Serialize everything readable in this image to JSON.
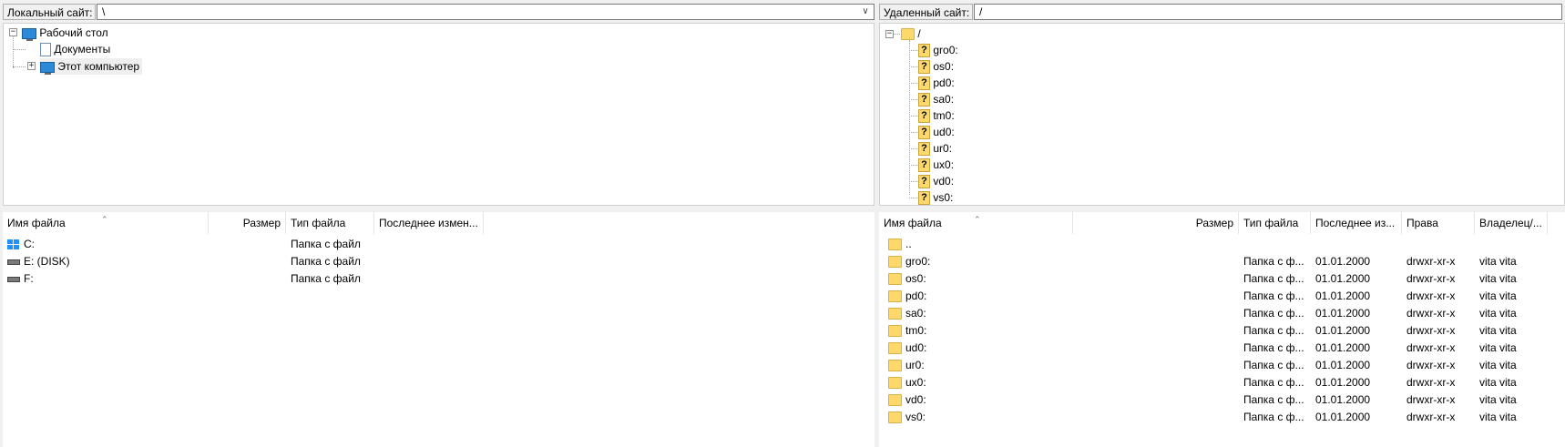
{
  "local": {
    "site_label": "Локальный сайт:",
    "path": "\\",
    "tree": [
      {
        "label": "Рабочий стол",
        "icon": "desktop-icon",
        "expander": "−"
      },
      {
        "label": "Документы",
        "icon": "documents-icon"
      },
      {
        "label": "Этот компьютер",
        "icon": "computer-icon",
        "expander": "+"
      }
    ],
    "columns": [
      "Имя файла",
      "Размер",
      "Тип файла",
      "Последнее измен..."
    ],
    "files": [
      {
        "name": "C:",
        "size": "",
        "type": "Папка с файл",
        "modified": "",
        "icon": "windows-drive-icon"
      },
      {
        "name": "E: (DISK)",
        "size": "",
        "type": "Папка с файл",
        "modified": "",
        "icon": "drive-icon"
      },
      {
        "name": "F:",
        "size": "",
        "type": "Папка с файл",
        "modified": "",
        "icon": "drive-icon"
      }
    ]
  },
  "remote": {
    "site_label": "Удаленный сайт:",
    "path": "/",
    "tree_root": "/",
    "tree_root_expander": "−",
    "tree": [
      "gro0:",
      "os0:",
      "pd0:",
      "sa0:",
      "tm0:",
      "ud0:",
      "ur0:",
      "ux0:",
      "vd0:",
      "vs0:"
    ],
    "columns": [
      "Имя файла",
      "Размер",
      "Тип файла",
      "Последнее из...",
      "Права",
      "Владелец/..."
    ],
    "parent_entry": "..",
    "files": [
      {
        "name": "gro0:",
        "type": "Папка с ф...",
        "modified": "01.01.2000",
        "perms": "drwxr-xr-x",
        "owner": "vita vita"
      },
      {
        "name": "os0:",
        "type": "Папка с ф...",
        "modified": "01.01.2000",
        "perms": "drwxr-xr-x",
        "owner": "vita vita"
      },
      {
        "name": "pd0:",
        "type": "Папка с ф...",
        "modified": "01.01.2000",
        "perms": "drwxr-xr-x",
        "owner": "vita vita"
      },
      {
        "name": "sa0:",
        "type": "Папка с ф...",
        "modified": "01.01.2000",
        "perms": "drwxr-xr-x",
        "owner": "vita vita"
      },
      {
        "name": "tm0:",
        "type": "Папка с ф...",
        "modified": "01.01.2000",
        "perms": "drwxr-xr-x",
        "owner": "vita vita"
      },
      {
        "name": "ud0:",
        "type": "Папка с ф...",
        "modified": "01.01.2000",
        "perms": "drwxr-xr-x",
        "owner": "vita vita"
      },
      {
        "name": "ur0:",
        "type": "Папка с ф...",
        "modified": "01.01.2000",
        "perms": "drwxr-xr-x",
        "owner": "vita vita"
      },
      {
        "name": "ux0:",
        "type": "Папка с ф...",
        "modified": "01.01.2000",
        "perms": "drwxr-xr-x",
        "owner": "vita vita"
      },
      {
        "name": "vd0:",
        "type": "Папка с ф...",
        "modified": "01.01.2000",
        "perms": "drwxr-xr-x",
        "owner": "vita vita"
      },
      {
        "name": "vs0:",
        "type": "Папка с ф...",
        "modified": "01.01.2000",
        "perms": "drwxr-xr-x",
        "owner": "vita vita"
      }
    ]
  }
}
